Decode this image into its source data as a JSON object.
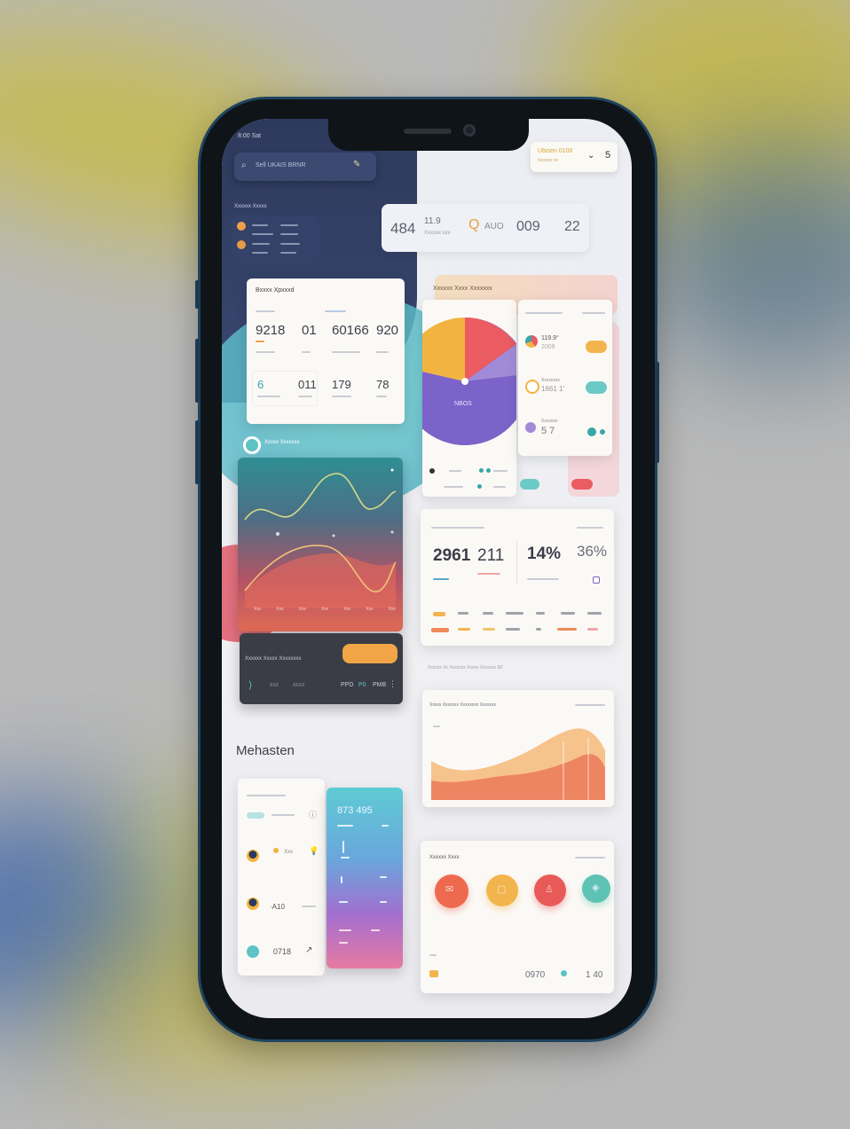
{
  "status": {
    "time": "8:00 Sat",
    "right_label": "Ubisen 0108",
    "right_sub": "Ixxxxxx xx",
    "right_num": "5"
  },
  "search": {
    "text": "Sell UKAIS BRNR"
  },
  "left_panel": {
    "title": "Xxxxxx Xxxxx"
  },
  "top_stats": {
    "v1": "484",
    "v2": "11.9",
    "v2_sub": "Xxxxxx xxx",
    "v3": "AUO",
    "v4": "009",
    "v5": "22"
  },
  "stats_card": {
    "title": "Bxxxx Xpxxxd",
    "row1": [
      "9218",
      "01",
      "60166",
      "920"
    ],
    "row2": [
      "6",
      "011",
      "179",
      "78"
    ]
  },
  "pie_card": {
    "title": "Xxxxxx Xxxx Xxxxxxx",
    "center_label": "NBOS",
    "legend": [
      "119.9°",
      "2009",
      "Xxxxxxxx",
      "1661 1′",
      "Xxxxxxx",
      "5 7"
    ]
  },
  "line_card": {
    "title": "Xxxxx Xxxxxxx",
    "x_ticks": [
      "Xxx",
      "Xxx",
      "Xxx",
      "Xxx",
      "Xxx",
      "Xxx",
      "Xxx"
    ]
  },
  "player": {
    "label": "Xxxxxx Xxxxx Xxxxxxxx",
    "values": [
      "XXX",
      "XXXX",
      "PPD",
      "P0",
      "PMB"
    ]
  },
  "kpi_card": {
    "v1": "2961",
    "v2": "211",
    "v3": "14%",
    "v4": "36%"
  },
  "caption": "Xxxxxx Xx Xxxxxxx Xxxxx Xxxxxxx 80′",
  "area_card": {
    "title": "Xxxxx Xxxxxxx Xxxxxxxx Xxxxxxx"
  },
  "section_title": "Mehasten",
  "list_card": {
    "items": [
      "Xxx",
      "·A10",
      "0718"
    ]
  },
  "gradient_card": {
    "title": "873 495"
  },
  "circles_card": {
    "title": "Xxxxxx Xxxx",
    "footer_v1": "0970",
    "footer_v2": "1 40"
  },
  "colors": {
    "navy": "#2d3a5c",
    "teal": "#5ec3c4",
    "orange": "#f0a048",
    "red": "#e8585e",
    "purple": "#7a62c9",
    "yellow": "#f3b240"
  }
}
